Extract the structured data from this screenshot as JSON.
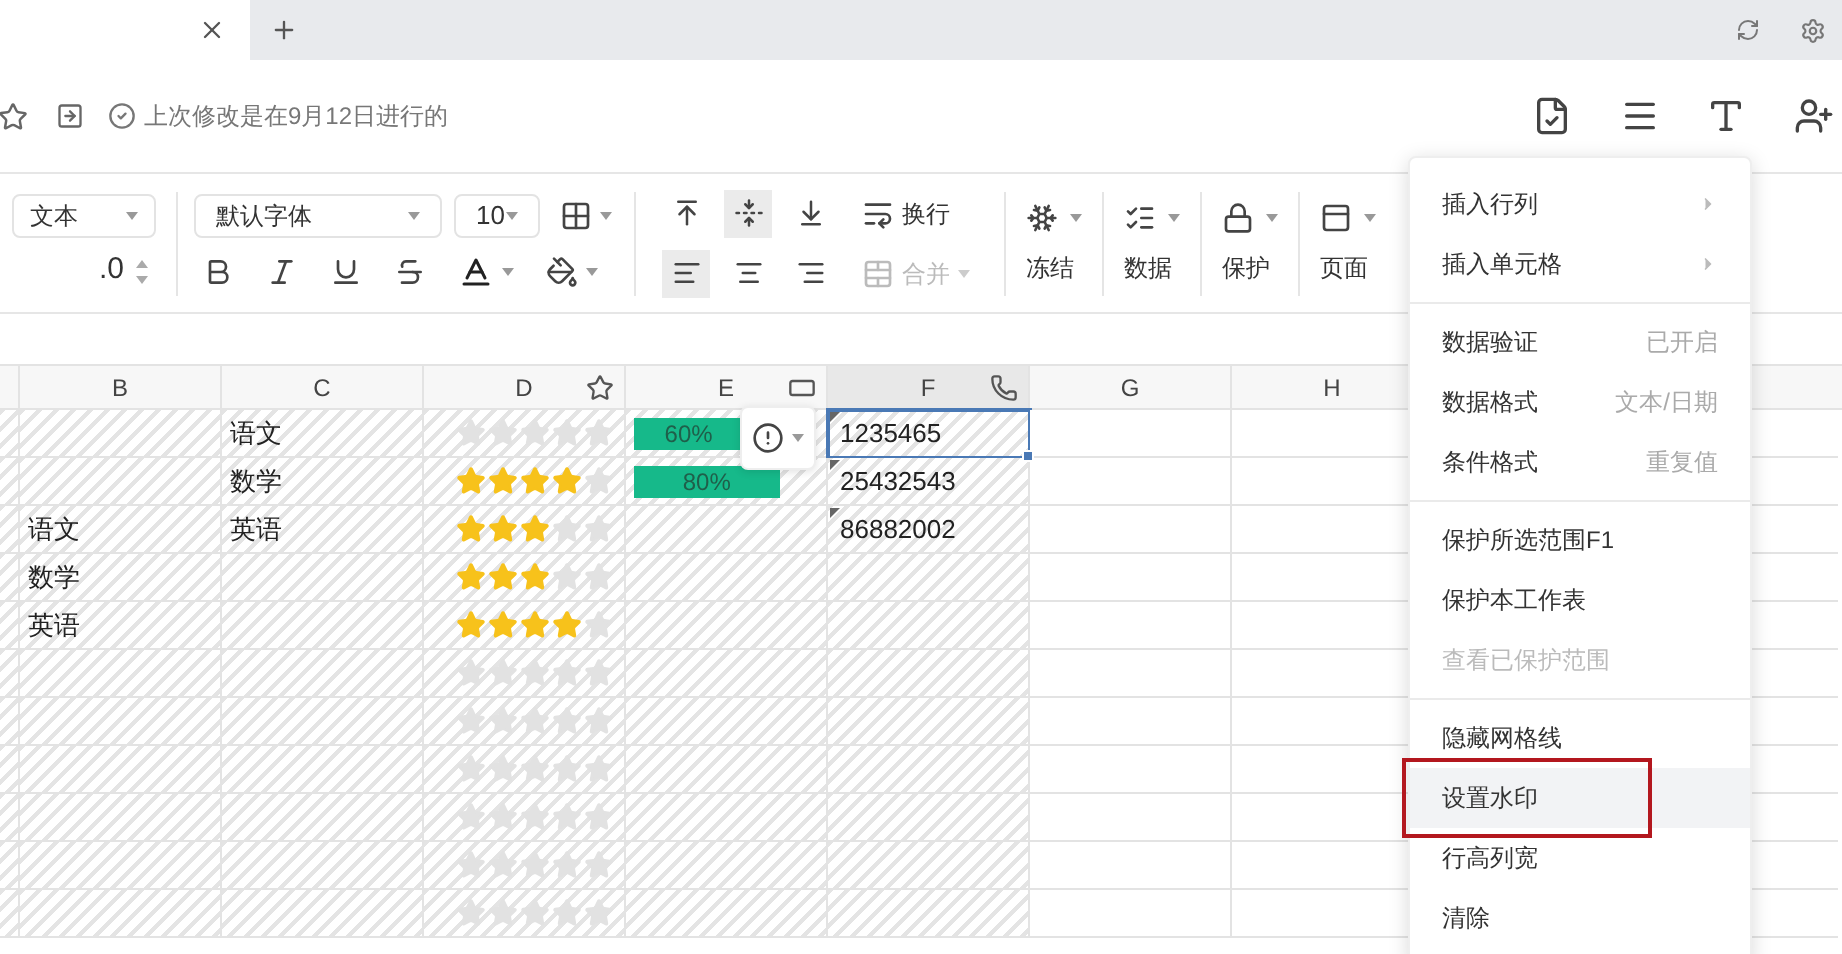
{
  "document_bar": {
    "status": "上次修改是在9月12日进行的"
  },
  "toolbar": {
    "number_format": "文本",
    "decimals": ".0",
    "font": "默认字体",
    "font_size": "10",
    "wrap": "换行",
    "merge": {
      "label": "合并",
      "disabled": true
    },
    "vertical_align": [
      {
        "kind": "top",
        "selected": false
      },
      {
        "kind": "middle",
        "selected": true
      },
      {
        "kind": "bottom",
        "selected": false
      }
    ],
    "horizontal_align": [
      {
        "kind": "left",
        "selected": true
      },
      {
        "kind": "center",
        "selected": false
      },
      {
        "kind": "right",
        "selected": false
      }
    ],
    "groups": [
      {
        "kind": "freeze",
        "label": "冻结"
      },
      {
        "kind": "data",
        "label": "数据"
      },
      {
        "kind": "protect",
        "label": "保护"
      },
      {
        "kind": "page",
        "label": "页面"
      }
    ]
  },
  "sheet": {
    "columns": [
      {
        "label": "B",
        "kind": "plain",
        "protected": true,
        "selected": false
      },
      {
        "label": "C",
        "kind": "plain",
        "protected": true,
        "selected": false
      },
      {
        "label": "D",
        "kind": "rating",
        "protected": true,
        "selected": false
      },
      {
        "label": "E",
        "kind": "progress",
        "protected": true,
        "selected": false
      },
      {
        "label": "F",
        "kind": "phone",
        "protected": true,
        "selected": true
      },
      {
        "label": "G",
        "kind": "plain",
        "protected": false,
        "selected": false
      },
      {
        "label": "H",
        "kind": "plain",
        "protected": false,
        "selected": false
      }
    ],
    "rows": [
      {
        "column_c": "语文",
        "stars": 0,
        "progress": {
          "level": 0.6,
          "reading": "60%"
        },
        "column_f": "1235465",
        "selected": true
      },
      {
        "column_c": "数学",
        "stars": 4,
        "progress": {
          "level": 0.8,
          "reading": "80%"
        },
        "column_f": "25432543",
        "selected": false
      },
      {
        "column_b": "语文",
        "column_c": "英语",
        "stars": 3,
        "column_f": "86882002",
        "selected": false
      },
      {
        "column_b": "数学",
        "stars": 3,
        "selected": false
      },
      {
        "column_b": "英语",
        "stars": 4,
        "selected": false
      },
      {
        "stars": 0,
        "selected": false
      },
      {
        "stars": 0,
        "selected": false
      },
      {
        "stars": 0,
        "selected": false
      },
      {
        "stars": 0,
        "selected": false
      },
      {
        "stars": 0,
        "selected": false
      },
      {
        "stars": 0,
        "selected": false
      }
    ]
  },
  "context_menu": {
    "sections": [
      {
        "items": [
          {
            "label": "插入行列",
            "submenu": true,
            "disabled": false,
            "selected": false,
            "annotated": false
          },
          {
            "label": "插入单元格",
            "submenu": true,
            "disabled": false,
            "selected": false,
            "annotated": false
          }
        ]
      },
      {
        "items": [
          {
            "label": "数据验证",
            "hint": "已开启",
            "submenu": false,
            "disabled": false,
            "selected": false,
            "annotated": false
          },
          {
            "label": "数据格式",
            "hint": "文本/日期",
            "submenu": false,
            "disabled": false,
            "selected": false,
            "annotated": false
          },
          {
            "label": "条件格式",
            "hint": "重复值",
            "submenu": false,
            "disabled": false,
            "selected": false,
            "annotated": false
          }
        ]
      },
      {
        "items": [
          {
            "label": "保护所选范围F1",
            "submenu": false,
            "disabled": false,
            "selected": false,
            "annotated": false
          },
          {
            "label": "保护本工作表",
            "submenu": false,
            "disabled": false,
            "selected": false,
            "annotated": false
          },
          {
            "label": "查看已保护范围",
            "submenu": false,
            "disabled": true,
            "selected": false,
            "annotated": false
          }
        ]
      },
      {
        "items": [
          {
            "label": "隐藏网格线",
            "submenu": false,
            "disabled": false,
            "selected": false,
            "annotated": false
          },
          {
            "label": "设置水印",
            "submenu": false,
            "disabled": false,
            "selected": true,
            "annotated": true
          },
          {
            "label": "行高列宽",
            "submenu": false,
            "disabled": false,
            "selected": false,
            "annotated": false
          },
          {
            "label": "清除",
            "submenu": false,
            "disabled": false,
            "selected": false,
            "annotated": false
          }
        ]
      }
    ]
  }
}
